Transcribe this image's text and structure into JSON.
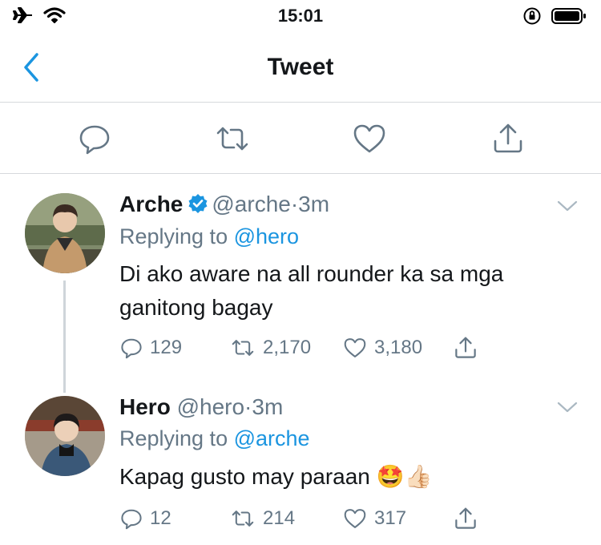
{
  "status_bar": {
    "time": "15:01"
  },
  "nav": {
    "title": "Tweet"
  },
  "tweets": [
    {
      "display_name": "Arche",
      "handle": "@arche",
      "separator": "·",
      "time": "3m",
      "verified": true,
      "replying_prefix": "Replying to",
      "replying_to": "@hero",
      "text": "Di ako aware na all rounder ka sa mga ganitong bagay",
      "replies": "129",
      "retweets": "2,170",
      "likes": "3,180"
    },
    {
      "display_name": "Hero",
      "handle": "@hero",
      "separator": "·",
      "time": "3m",
      "verified": false,
      "replying_prefix": "Replying to",
      "replying_to": "@arche",
      "text": "Kapag gusto may paraan 🤩👍🏻",
      "replies": "12",
      "retweets": "214",
      "likes": "317"
    }
  ],
  "colors": {
    "accent": "#1b95e0",
    "secondary_text": "#657786",
    "divider": "#d6d9dc"
  }
}
